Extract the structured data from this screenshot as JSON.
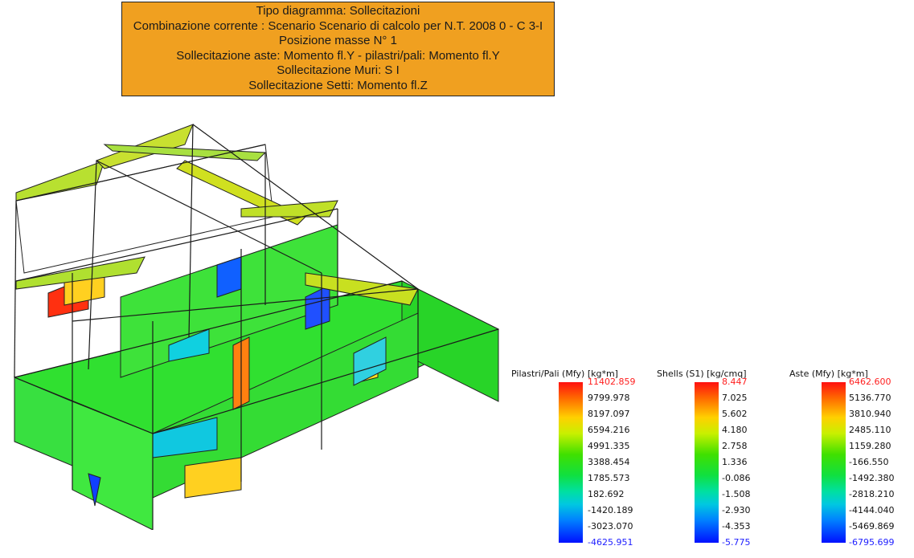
{
  "info": {
    "lines": [
      "Tipo diagramma: Sollecitazioni",
      "Combinazione corrente : Scenario Scenario di calcolo per N.T. 2008 0 - C 3-I",
      "Posizione masse N° 1",
      "Sollecitazione aste: Momento fl.Y - pilastri/pali: Momento fl.Y",
      "Sollecitazione Muri: S I",
      "Sollecitazione Setti: Momento fl.Z"
    ]
  },
  "legends": [
    {
      "title": "Pilastri/Pali (Mfy) [kg*m]",
      "ticks": [
        "11402.859",
        "9799.978",
        "8197.097",
        "6594.216",
        "4991.335",
        "3388.454",
        "1785.573",
        "182.692",
        "-1420.189",
        "-3023.070",
        "-4625.951"
      ]
    },
    {
      "title": "Shells (S1) [kg/cmq]",
      "ticks": [
        "8.447",
        "7.025",
        "5.602",
        "4.180",
        "2.758",
        "1.336",
        "-0.086",
        "-1.508",
        "-2.930",
        "-4.353",
        "-5.775"
      ]
    },
    {
      "title": "Aste (Mfy) [kg*m]",
      "ticks": [
        "6462.600",
        "5136.770",
        "3810.940",
        "2485.110",
        "1159.280",
        "-166.550",
        "-1492.380",
        "-2818.210",
        "-4144.040",
        "-5469.869",
        "-6795.699"
      ]
    }
  ],
  "colors": {
    "header_bg": "#f0a020",
    "max_value": "#ff2020",
    "min_value": "#2020ff",
    "model_green": "#2ee02e"
  }
}
